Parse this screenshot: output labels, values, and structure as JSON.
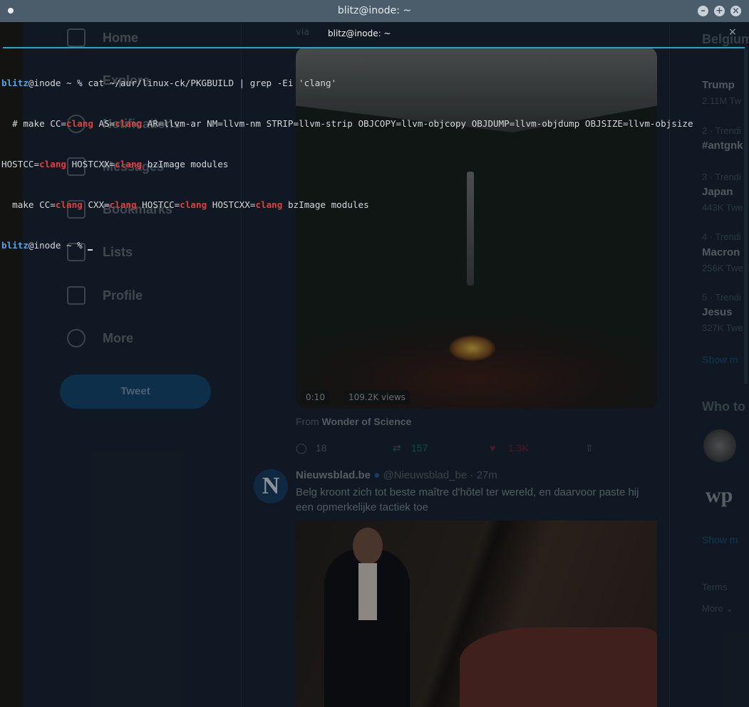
{
  "window": {
    "title": "blitz@inode: ~",
    "tab_title": "blitz@inode: ~"
  },
  "twitter": {
    "nav": [
      "Home",
      "Explore",
      "Notifications",
      "Messages",
      "Bookmarks",
      "Lists",
      "Profile",
      "More"
    ],
    "tweet_button": "Tweet",
    "video": {
      "time": "0:10",
      "views": "109.2K views"
    },
    "from_prefix": "From ",
    "from_source": "Wonder of Science",
    "via": "via",
    "actions": {
      "replies": "18",
      "retweets": "157",
      "likes": "1.3K"
    },
    "tweet": {
      "author": "Nieuwsblad.be",
      "handle": "@Nieuwsblad_be · 27m",
      "text": "Belg kroont zich tot beste maître d'hôtel ter wereld, en daarvoor paste hij een opmerkelijke tactiek toe"
    },
    "trends": {
      "header": "Belgium",
      "items": [
        {
          "rank": "",
          "name": "Trump",
          "count": "2.11M Tw"
        },
        {
          "rank": "2 · Trendi",
          "name": "#antgnk",
          "count": ""
        },
        {
          "rank": "3 · Trendi",
          "name": "Japan",
          "count": "443K Twe"
        },
        {
          "rank": "4 · Trendi",
          "name": "Macron",
          "count": "256K Twe"
        },
        {
          "rank": "5 · Trendi",
          "name": "Jesus",
          "count": "327K Twe"
        }
      ],
      "show_more": "Show m"
    },
    "who_to_follow": "Who to",
    "show_more2": "Show m",
    "terms": "Terms",
    "more": "More"
  },
  "terminal": {
    "prompt_user": "blitz",
    "prompt_rest": "@inode ~ % ",
    "command": "cat ~/aur/linux-ck/PKGBUILD | grep -Ei 'clang'",
    "match": "clang",
    "l2": [
      "  # make CC=",
      "clang",
      " AS=",
      "clang",
      " AR=llvm-ar NM=llvm-nm STRIP=llvm-strip OBJCOPY=llvm-objcopy OBJDUMP=llvm-objdump OBJSIZE=llvm-objsize"
    ],
    "l3": [
      "HOSTCC=",
      "clang",
      " HOSTCXX=",
      "clang",
      " bzImage modules"
    ],
    "l4": [
      "  make CC=",
      "clang",
      " CXX=",
      "clang",
      " HOSTCC=",
      "clang",
      " HOSTCXX=",
      "clang",
      " bzImage modules"
    ]
  }
}
